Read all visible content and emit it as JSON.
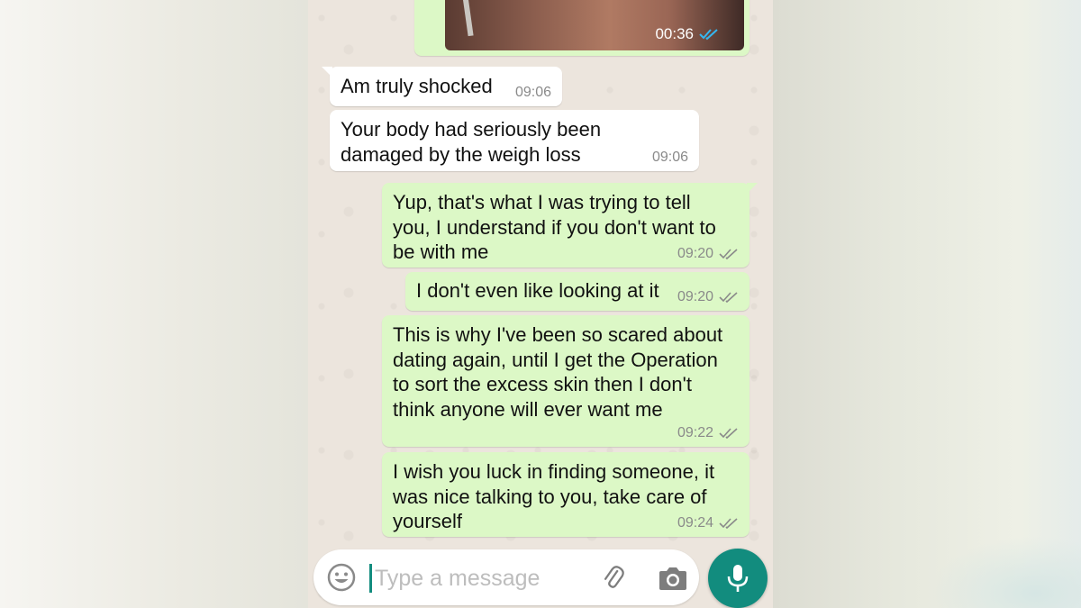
{
  "media": {
    "time": "00:36",
    "status": "read"
  },
  "messages": [
    {
      "direction": "incoming",
      "text": "Am truly shocked",
      "time": "09:06"
    },
    {
      "direction": "incoming",
      "lines": [
        "Your body had seriously been",
        "damaged by the weigh loss"
      ],
      "time": "09:06"
    },
    {
      "direction": "outgoing",
      "lines": [
        "Yup, that's what I was trying to tell",
        "you, I understand if you don't want to",
        "be with me"
      ],
      "time": "09:20",
      "status": "delivered"
    },
    {
      "direction": "outgoing",
      "text": "I don't even like looking at it",
      "time": "09:20",
      "status": "delivered"
    },
    {
      "direction": "outgoing",
      "lines": [
        "This is why I've been so scared about",
        "dating again, until I get the Operation",
        "to sort the excess skin then I don't",
        "think anyone will ever want me"
      ],
      "time": "09:22",
      "status": "delivered"
    },
    {
      "direction": "outgoing",
      "lines": [
        "I wish you luck in finding someone, it",
        "was nice talking to you, take care of",
        "yourself"
      ],
      "time": "09:24",
      "status": "delivered"
    }
  ],
  "composer": {
    "placeholder": "Type a message",
    "icons": {
      "emoji": "smiley-icon",
      "attach": "paperclip-icon",
      "camera": "camera-icon",
      "mic": "microphone-icon"
    }
  },
  "colors": {
    "chat_background": "#ece5dd",
    "incoming_bubble": "#ffffff",
    "outgoing_bubble": "#dcf8c6",
    "accent": "#128c7e",
    "read_ticks": "#34b7f1",
    "delivered_ticks": "#8a8a8a"
  }
}
